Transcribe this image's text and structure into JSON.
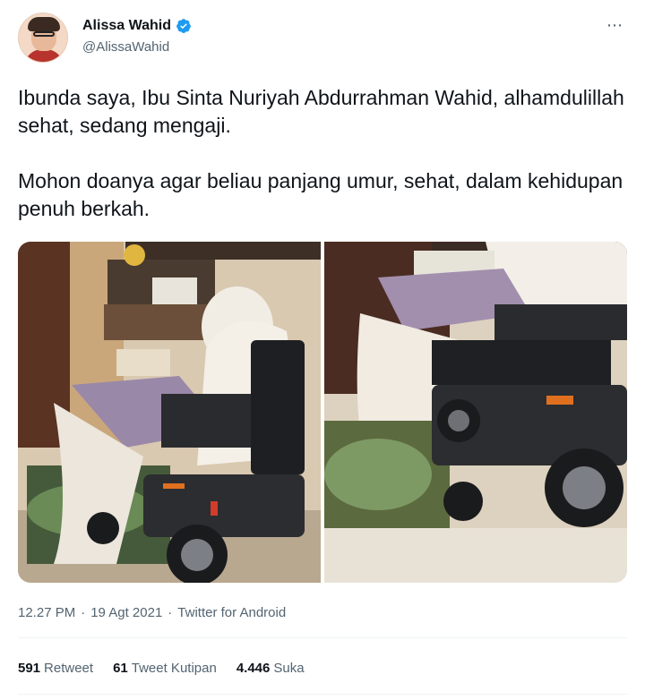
{
  "author": {
    "display_name": "Alissa Wahid",
    "handle": "@AlissaWahid",
    "verified": true
  },
  "more_icon": "⋯",
  "tweet": {
    "paragraphs": [
      "Ibunda saya, Ibu Sinta Nuriyah Abdurrahman Wahid, alhamdulillah sehat, sedang mengaji.",
      "Mohon doanya agar beliau panjang umur, sehat, dalam kehidupan penuh berkah."
    ]
  },
  "meta": {
    "time": "12.27 PM",
    "sep1": "·",
    "date": "19 Agt 2021",
    "sep2": "·",
    "source": "Twitter for Android"
  },
  "stats": {
    "retweets_count": "591",
    "retweets_label": "Retweet",
    "quotes_count": "61",
    "quotes_label": "Tweet Kutipan",
    "likes_count": "4.446",
    "likes_label": "Suka"
  },
  "colors": {
    "verified_badge": "#1d9bf0",
    "secondary_text": "#536471",
    "primary_text": "#0f1419",
    "divider": "#eff3f4"
  }
}
